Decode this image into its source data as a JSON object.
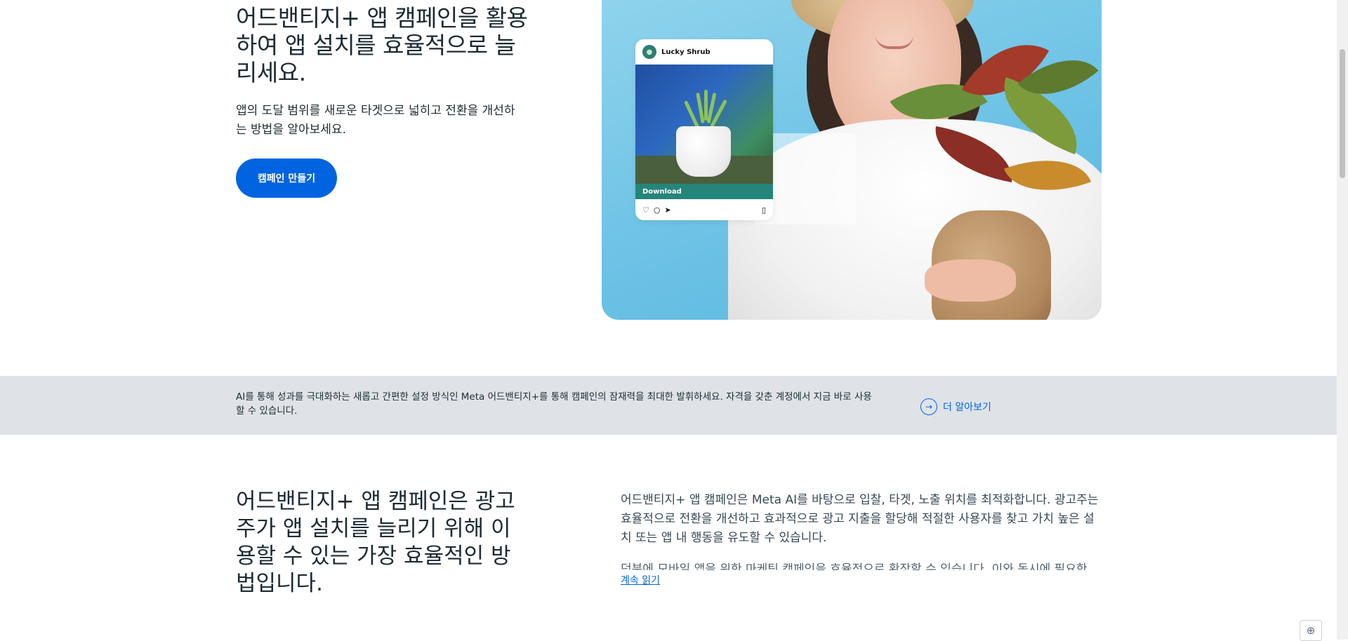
{
  "hero": {
    "title": "어드밴티지+ 앱 캠페인을 활용하여 앱 설치를 효율적으로 늘리세요.",
    "subtitle": "앱의 도달 범위를 새로운 타겟으로 넓히고 전환을 개선하는 방법을 알아보세요.",
    "cta_label": "캠페인 만들기"
  },
  "post_card": {
    "account_name": "Lucky Shrub",
    "download_label": "Download"
  },
  "banner": {
    "text": "AI를 통해 성과를 극대화하는 새롭고 간편한 설정 방식인 Meta 어드밴티지+를 통해 캠페인의 잠재력을 최대한 발휘하세요. 자격을 갖춘 계정에서 지금 바로 사용할 수 있습니다.",
    "link_label": "더 알아보기"
  },
  "section2": {
    "title": "어드밴티지+ 앱 캠페인은 광고주가 앱 설치를 늘리기 위해 이용할 수 있는 가장 효율적인 방법입니다.",
    "body": "어드밴티지+ 앱 캠페인은 Meta AI를 바탕으로 입찰, 타겟, 노출 위치를 최적화합니다. 광고주는 효율적으로 전환을 개선하고 효과적으로 광고 지출을 할당해 적절한 사용자를 찾고 가치 높은 설치 또는 앱 내 행동을 유도할 수 있습니다.",
    "body_clipped": "덕분에 모바일 앱을 위한 마케팅 캠페인을 효율적으로 확장할 수 있습니다. 이와 동시에 필요한",
    "read_more_label": "계속 읽기"
  },
  "icons": {
    "banner_link_icon": "arrow-circle-icon",
    "language_icon": "globe-icon"
  },
  "colors": {
    "primary": "#0064e0",
    "banner_bg": "#dfe3e8",
    "text": "#1c2b33",
    "download_bar": "#25857a"
  }
}
